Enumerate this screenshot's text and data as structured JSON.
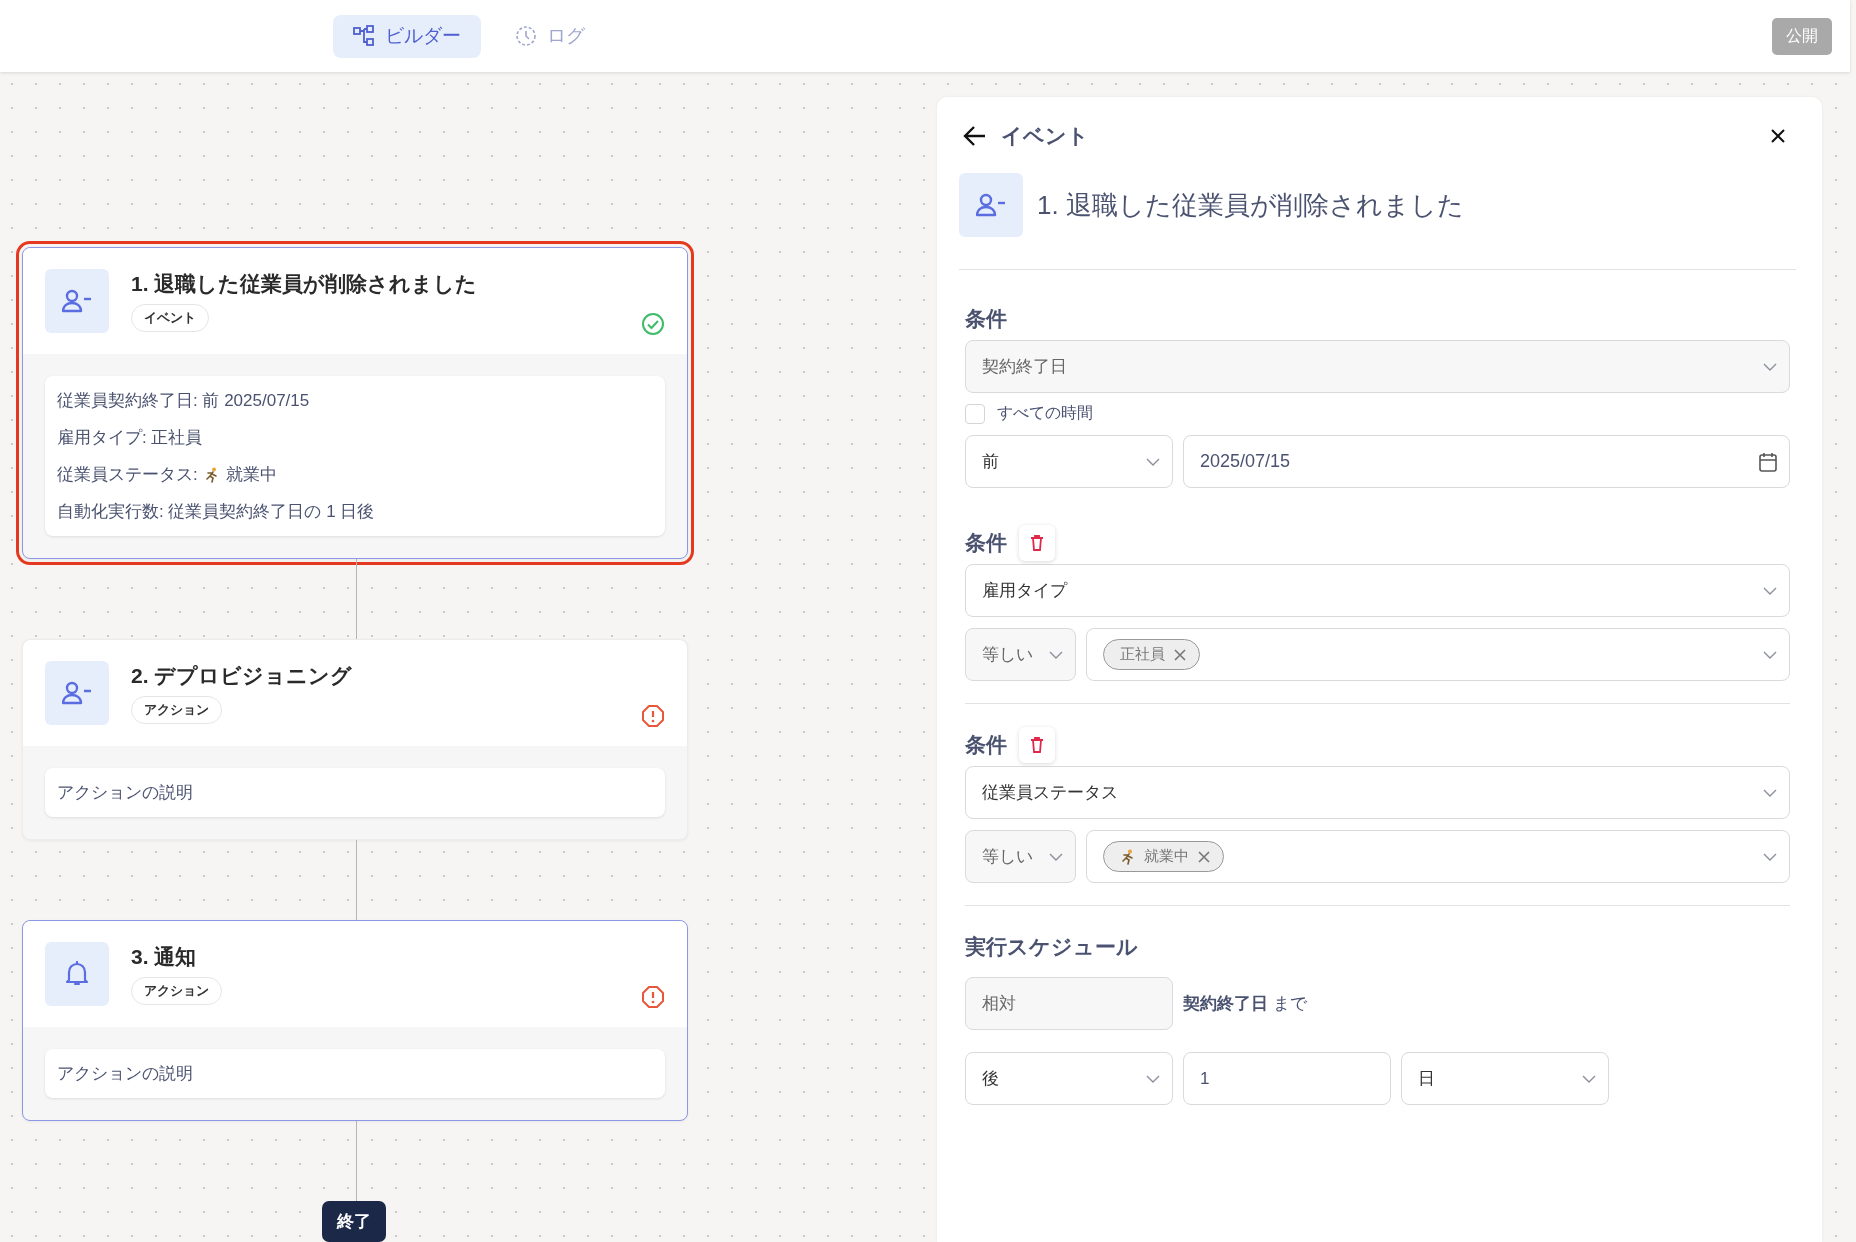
{
  "top_bar": {
    "tabs": [
      {
        "label": "ビルダー",
        "selected": true,
        "kind": "builder"
      },
      {
        "label": "ログ",
        "selected": false,
        "kind": "log"
      }
    ],
    "publish_button": {
      "label": "公開",
      "disabled": true
    }
  },
  "flow": {
    "nodes": [
      {
        "title": "1. 退職した従業員が削除されました",
        "badge": "イベント",
        "kind": "person",
        "valid": true,
        "selected": true,
        "highlighted": true,
        "details": [
          {
            "text": "従業員契約終了日: 前 2025/07/15"
          },
          {
            "text": "雇用タイプ: 正社員"
          },
          {
            "text": "従業員ステータス:",
            "kind": "status",
            "value": "就業中"
          },
          {
            "text": "自動化実行数: 従業員契約終了日の 1 日後"
          }
        ]
      },
      {
        "title": "2. デプロビジョニング",
        "badge": "アクション",
        "kind": "person",
        "valid": false,
        "selected": false,
        "highlighted": false,
        "details": [
          {
            "text": "アクションの説明"
          }
        ]
      },
      {
        "title": "3. 通知",
        "badge": "アクション",
        "kind": "bell",
        "valid": false,
        "selected": false,
        "highlighted": true,
        "details": [
          {
            "text": "アクションの説明"
          }
        ]
      }
    ],
    "end_label": "終了"
  },
  "panel": {
    "back_label": "イベント",
    "title": "1. 退職した従業員が削除されました",
    "conditions": [
      {
        "label": "条件",
        "deletable": false,
        "kind": "date",
        "field": "契約終了日",
        "field_disabled": true,
        "all_time": {
          "label": "すべての時間",
          "checked": false
        },
        "operator": "前",
        "value": "2025/07/15"
      },
      {
        "label": "条件",
        "deletable": true,
        "kind": "tags",
        "field": "雇用タイプ",
        "field_disabled": false,
        "operator": "等しい",
        "tags": [
          {
            "label": "正社員"
          }
        ]
      },
      {
        "label": "条件",
        "deletable": true,
        "kind": "tags",
        "field": "従業員ステータス",
        "field_disabled": false,
        "operator": "等しい",
        "tags": [
          {
            "label": "就業中",
            "kind": "status"
          }
        ]
      }
    ],
    "schedule": {
      "label": "実行スケジュール",
      "mode": "相対",
      "anchor_text": "**契約終了日** まで",
      "direction": "後",
      "amount": "1",
      "unit": "日"
    }
  }
}
